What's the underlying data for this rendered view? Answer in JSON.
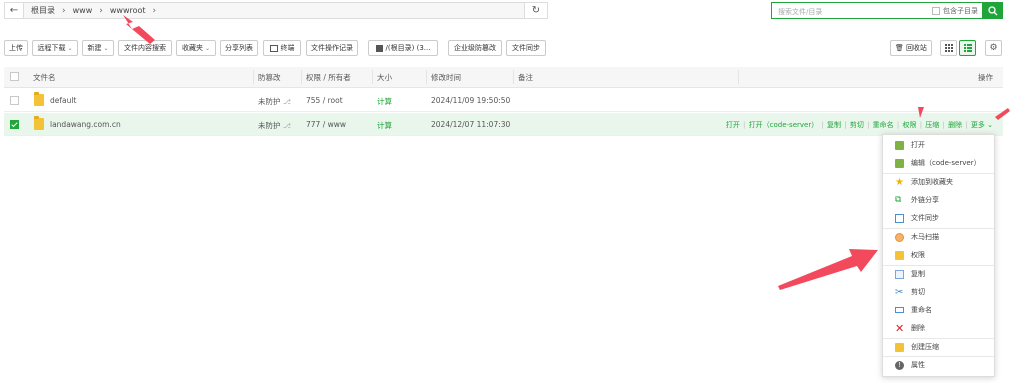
{
  "pathbar": {
    "crumbs": [
      "根目录",
      "www",
      "wwwroot"
    ],
    "search_placeholder": "搜索文件/目录",
    "include_subdir_label": "包含子目录"
  },
  "toolbar": {
    "upload": "上传",
    "remote_download": "远程下载",
    "new": "新建",
    "content_search": "文件内容搜索",
    "favorites": "收藏夹",
    "share_list": "分享列表",
    "terminal": "终端",
    "op_log": "文件操作记录",
    "disk": "/(根目录) (3...",
    "tamper_protect": "企业级防篡改",
    "file_sync": "文件同步",
    "recycle_bin": "回收站"
  },
  "table": {
    "headers": {
      "name": "文件名",
      "tamper": "防篡改",
      "perm": "权限 / 所有者",
      "size": "大小",
      "mtime": "修改时间",
      "note": "备注",
      "ops": "操作"
    },
    "rows": [
      {
        "name": "default",
        "tamper": "未防护",
        "perm": "755 / root",
        "size": "计算",
        "mtime": "2024/11/09 19:50:50",
        "selected": false
      },
      {
        "name": "landawang.com.cn",
        "tamper": "未防护",
        "perm": "777 / www",
        "size": "计算",
        "mtime": "2024/12/07 11:07:30",
        "selected": true
      }
    ],
    "row_ops": [
      "打开",
      "打开（code-server）",
      "复制",
      "剪切",
      "重命名",
      "权限",
      "压缩",
      "删除",
      "更多"
    ]
  },
  "context_menu": {
    "items": [
      {
        "label": "打开",
        "icon": "open-icon",
        "color": "#6aa84f"
      },
      {
        "label": "编辑（code-server）",
        "icon": "edit-icon",
        "color": "#6aa84f"
      },
      {
        "label": "添加到收藏夹",
        "icon": "star-icon",
        "color": "#f0b400"
      },
      {
        "label": "外链分享",
        "icon": "share-icon",
        "color": "#20a53a"
      },
      {
        "label": "文件同步",
        "icon": "sync-icon",
        "color": "#4a90d9"
      },
      {
        "label": "木马扫描",
        "icon": "scan-icon",
        "color": "#e69138"
      },
      {
        "label": "权限",
        "icon": "permission-icon",
        "color": "#f0b400"
      },
      {
        "label": "复制",
        "icon": "copy-icon",
        "color": "#4a90d9"
      },
      {
        "label": "剪切",
        "icon": "cut-icon",
        "color": "#3d85c6"
      },
      {
        "label": "重命名",
        "icon": "rename-icon",
        "color": "#4a90d9"
      },
      {
        "label": "删除",
        "icon": "delete-icon",
        "color": "#e02020"
      },
      {
        "label": "创建压缩",
        "icon": "compress-icon",
        "color": "#f0b400"
      },
      {
        "label": "属性",
        "icon": "info-icon",
        "color": "#666666"
      }
    ]
  },
  "colors": {
    "accent": "#20a53a",
    "arrow": "#f24a5c"
  }
}
